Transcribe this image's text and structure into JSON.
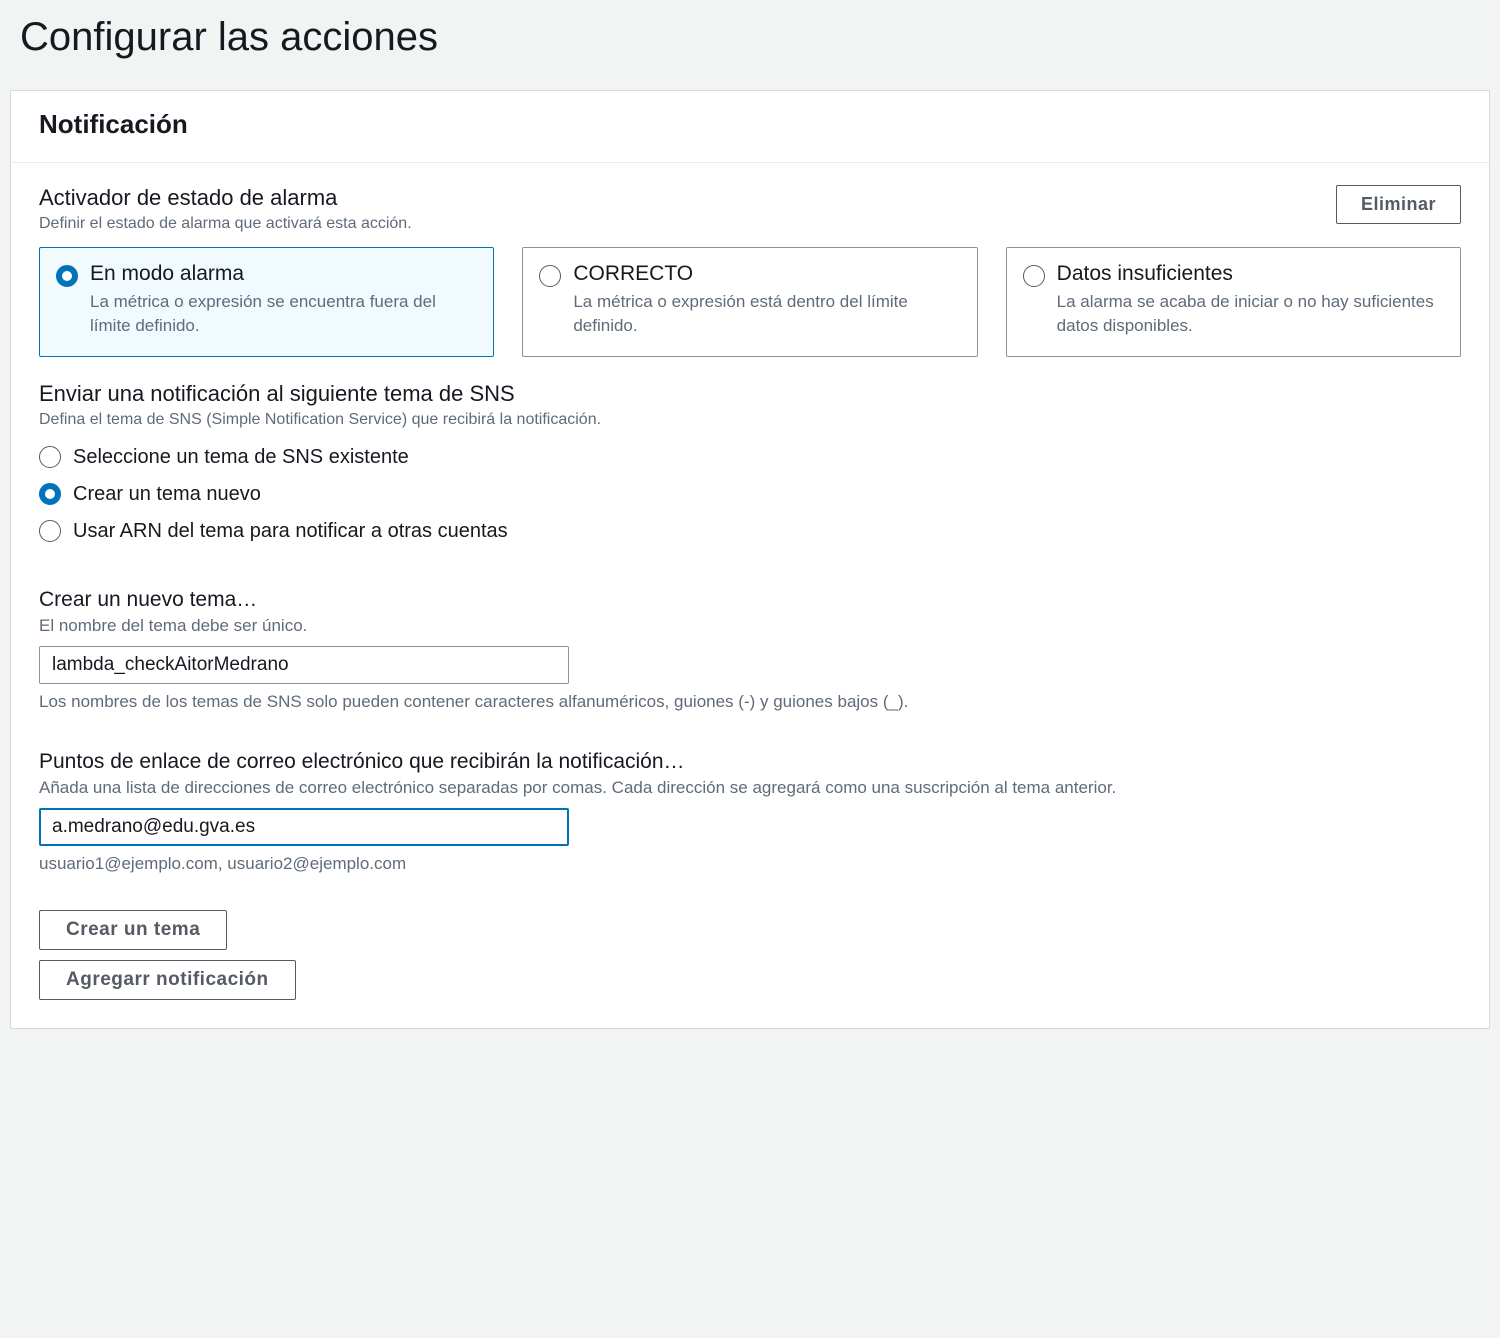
{
  "page": {
    "title": "Configurar las acciones"
  },
  "panel": {
    "heading": "Notificación"
  },
  "trigger": {
    "label": "Activador de estado de alarma",
    "sublabel": "Definir el estado de alarma que activará esta acción.",
    "delete_button": "Eliminar",
    "selected": 0,
    "options": [
      {
        "title": "En modo alarma",
        "desc": "La métrica o expresión se encuentra fuera del límite definido."
      },
      {
        "title": "CORRECTO",
        "desc": "La métrica o expresión está dentro del límite definido."
      },
      {
        "title": "Datos insuficientes",
        "desc": "La alarma se acaba de iniciar o no hay suficientes datos disponibles."
      }
    ]
  },
  "sns": {
    "label": "Enviar una notificación al siguiente tema de SNS",
    "sublabel": "Defina el tema de SNS (Simple Notification Service) que recibirá la notificación.",
    "selected": 1,
    "options": [
      "Seleccione un tema de SNS existente",
      "Crear un tema nuevo",
      "Usar ARN del tema para notificar a otras cuentas"
    ]
  },
  "topic": {
    "label": "Crear un nuevo tema…",
    "sublabel": "El nombre del tema debe ser único.",
    "value": "lambda_checkAitorMedrano",
    "help": "Los nombres de los temas de SNS solo pueden contener caracteres alfanuméricos, guiones (-) y guiones bajos (_)."
  },
  "emails": {
    "label": "Puntos de enlace de correo electrónico que recibirán la notificación…",
    "sublabel": "Añada una lista de direcciones de correo electrónico separadas por comas. Cada dirección se agregará como una suscripción al tema anterior.",
    "value": "a.medrano@edu.gva.es",
    "help": "usuario1@ejemplo.com, usuario2@ejemplo.com"
  },
  "buttons": {
    "create_topic": "Crear un tema",
    "add_notification": "Agregarr notificación"
  }
}
